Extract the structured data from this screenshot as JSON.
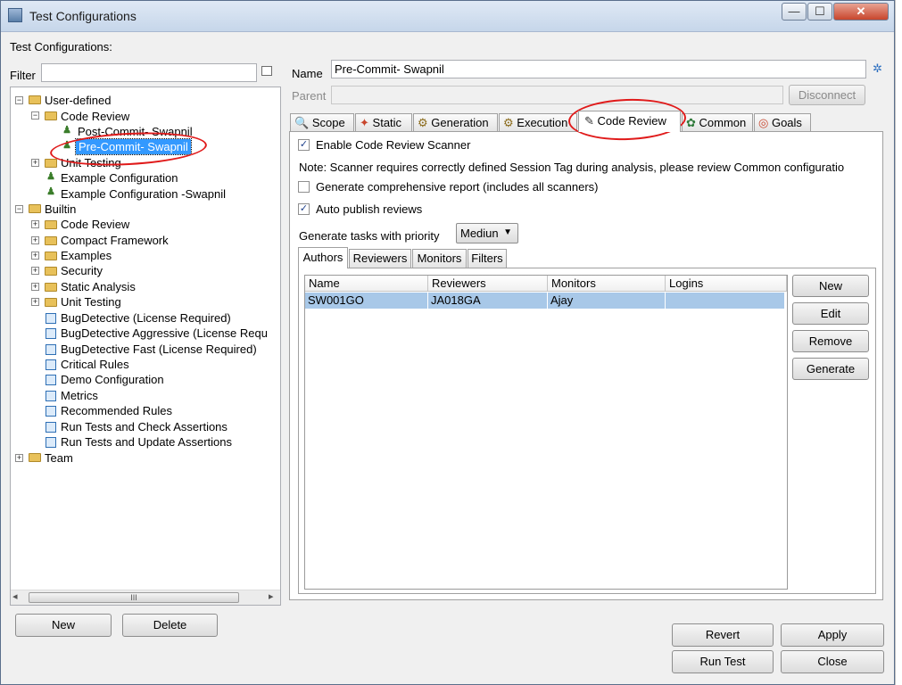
{
  "window": {
    "title": "Test Configurations",
    "min_glyph": "—",
    "max_glyph": "☐",
    "close_glyph": "✕"
  },
  "left": {
    "header": "Test Configurations:",
    "filter_label": "Filter",
    "filter_value": "",
    "new_label": "New",
    "delete_label": "Delete",
    "scroll_thumb_glyph": "III",
    "scroll_left_glyph": "◂",
    "scroll_right_glyph": "▸"
  },
  "tree": {
    "user_defined": "User-defined",
    "ud_code_review": "Code Review",
    "post_commit": "Post-Commit- Swapnil",
    "pre_commit": "Pre-Commit- Swapnil",
    "ud_unit_testing": "Unit Testing",
    "example_config": "Example Configuration",
    "example_config_swapnil": "Example Configuration -Swapnil",
    "builtin": "Builtin",
    "b_items": [
      "Code Review",
      "Compact Framework",
      "Examples",
      "Security",
      "Static Analysis",
      "Unit Testing"
    ],
    "b_configs": [
      "BugDetective (License Required)",
      "BugDetective Aggressive (License Requ",
      "BugDetective Fast (License Required)",
      "Critical Rules",
      "Demo Configuration",
      "Metrics",
      "Recommended Rules",
      "Run Tests and Check Assertions",
      "Run Tests and Update Assertions"
    ],
    "team": "Team"
  },
  "form": {
    "name_label": "Name",
    "name_value": "Pre-Commit- Swapnil",
    "parent_label": "Parent",
    "parent_value": "",
    "disconnect_label": "Disconnect"
  },
  "tabs": [
    "Scope",
    "Static",
    "Generation",
    "Execution",
    "Code Review",
    "Common",
    "Goals"
  ],
  "code_review": {
    "enable_label": "Enable Code Review Scanner",
    "enable_checked": true,
    "note": "Note: Scanner requires correctly defined Session Tag during analysis, please review Common configuratio",
    "comprehensive_label": "Generate comprehensive report (includes all scanners)",
    "comprehensive_checked": false,
    "autopublish_label": "Auto publish reviews",
    "autopublish_checked": true,
    "priority_label": "Generate tasks with priority",
    "priority_value": "Mediun",
    "subtabs": [
      "Authors",
      "Reviewers",
      "Monitors",
      "Filters"
    ],
    "columns": [
      "Name",
      "Reviewers",
      "Monitors",
      "Logins"
    ],
    "rows": [
      [
        "SW001GO",
        "JA018GA",
        "Ajay",
        ""
      ]
    ],
    "side_buttons": [
      "New",
      "Edit",
      "Remove",
      "Generate"
    ]
  },
  "footer": {
    "revert": "Revert",
    "apply": "Apply",
    "run_test": "Run Test",
    "close": "Close"
  },
  "colors": {
    "annotation": "#e01a1a",
    "selection": "#3399ff",
    "row_highlight": "#a8c8e8"
  }
}
